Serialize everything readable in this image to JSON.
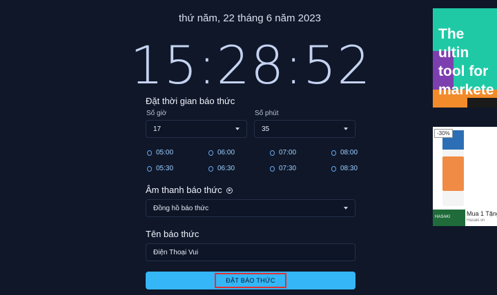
{
  "date_text": "thứ năm, 22 tháng 6 năm 2023",
  "clock_text": "15:28:52",
  "alarm_time": {
    "title": "Đặt thời gian báo thức",
    "hour_label": "Số giờ",
    "hour_value": "17",
    "minute_label": "Số phút",
    "minute_value": "35",
    "quick_times": [
      "05:00",
      "06:00",
      "07:00",
      "08:00",
      "05:30",
      "06:30",
      "07:30",
      "08:30"
    ]
  },
  "sound": {
    "title": "Âm thanh báo thức",
    "value": "Đồng hồ báo thức"
  },
  "name": {
    "title": "Tên báo thức",
    "value": "Điện Thoại Vui"
  },
  "submit_label": "ĐẶT BÁO THỨC",
  "ads": {
    "ad1_text": [
      "The ultin",
      "tool for",
      "markete"
    ],
    "ad2_badge": "-30%",
    "ad2_title": "Mua 1 Tặng",
    "ad2_brand": "HASAKI",
    "ad2_source": "Hasaki.vn"
  },
  "colors": {
    "background": "#0f1729",
    "button": "#35b6f7",
    "highlight": "#e03131",
    "quick_time": "#9fd0ff"
  }
}
